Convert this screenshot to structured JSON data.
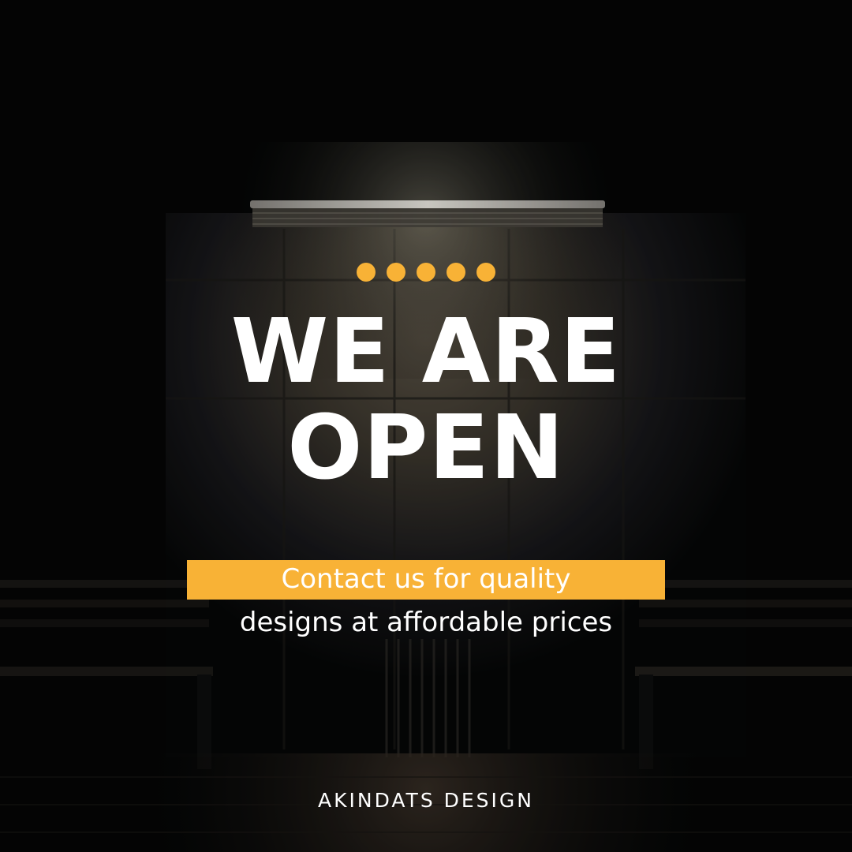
{
  "poster": {
    "headline": {
      "line1": "WE ARE",
      "line2": "OPEN"
    },
    "tagline": {
      "line1": "Contact us for quality",
      "line2": "designs at affordable prices"
    },
    "brand": "AKINDATS DESIGN",
    "decorative_dots_count": 5
  },
  "colors": {
    "accent": "#f8b236",
    "text": "#ffffff",
    "background": "#050606"
  }
}
